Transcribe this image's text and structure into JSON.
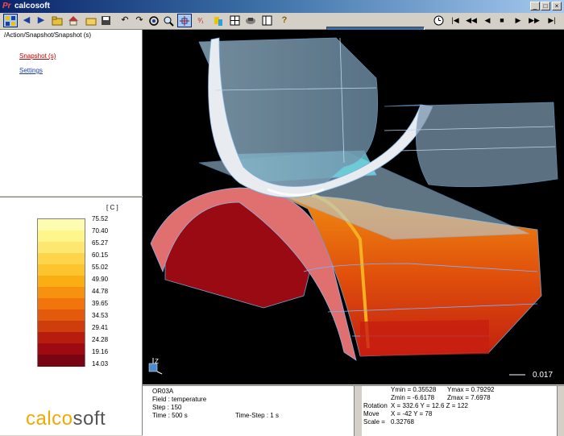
{
  "window": {
    "title": "calcosoft",
    "logo_text": "Pr"
  },
  "toolbar": {
    "icons": [
      "pointer-icon",
      "back-icon",
      "forward-icon",
      "open-folder-icon",
      "home-icon",
      "folder-icon",
      "save-icon",
      "rotate-left-icon",
      "rotate-right-icon",
      "fit-icon",
      "zoom-icon",
      "axes-icon",
      "pick-icon",
      "paint-icon",
      "grid-icon",
      "print-icon",
      "split-icon",
      "help-icon"
    ],
    "player": [
      "clock-icon",
      "first-icon",
      "step-back-icon",
      "play-back-icon",
      "stop-icon",
      "play-icon",
      "step-forward-icon",
      "last-icon"
    ]
  },
  "left": {
    "breadcrumb": "/Action/Snapshot/Snapshot (s)",
    "links": [
      "Snapshot (s)",
      "Settings"
    ]
  },
  "legend": {
    "unit": "[ C ]",
    "values": [
      "75.52",
      "70.40",
      "65.27",
      "60.15",
      "55.02",
      "49.90",
      "44.78",
      "39.65",
      "34.53",
      "29.41",
      "24.28",
      "19.16",
      "14.03"
    ],
    "colors": [
      "#fefcb0",
      "#fef68a",
      "#fde771",
      "#fdd44a",
      "#fdc42e",
      "#fbad14",
      "#f69210",
      "#f1740c",
      "#e45a0c",
      "#cf3d0d",
      "#b81c0f",
      "#9d0a12",
      "#7a0512"
    ]
  },
  "brand": {
    "part1": "calco",
    "part2": "soft"
  },
  "viewport": {
    "scale_value": "0.017",
    "axis_label": "Z"
  },
  "info": {
    "model": "OR03A",
    "field": "Field :  temperature",
    "step": "Step : 150",
    "time": "Time : 500 s",
    "timestep": "Time-Step : 1 s",
    "ymin": "Ymin = 0.35528",
    "ymax": "Ymax = 0.79292",
    "zmin": "Zmin = -6.6178",
    "zmax": "Zmax = 7.6978",
    "rotation_label": "Rotation",
    "rotation": "X = 332.6  Y = 12.6  Z = 122",
    "move_label": "Move",
    "move": "X = -42      Y = 78",
    "scale_label": "Scale =",
    "scale": "0.32768"
  }
}
